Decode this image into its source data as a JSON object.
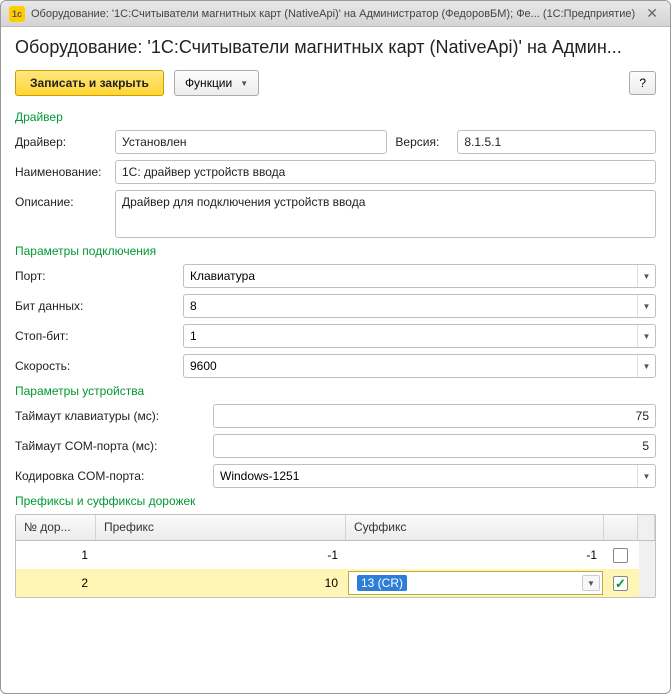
{
  "titlebar": {
    "text": "Оборудование: '1С:Считыватели магнитных карт (NativeApi)' на Администратор (ФедоровБМ); Фе...  (1С:Предприятие)"
  },
  "pageTitle": "Оборудование: '1С:Считыватели магнитных карт (NativeApi)' на Админ...",
  "toolbar": {
    "save": "Записать и закрыть",
    "functions": "Функции",
    "help": "?"
  },
  "sections": {
    "driver": "Драйвер",
    "connectionParams": "Параметры подключения",
    "deviceParams": "Параметры устройства",
    "trackAffixes": "Префиксы и суффиксы дорожек"
  },
  "driver": {
    "labels": {
      "driver": "Драйвер:",
      "version": "Версия:",
      "name": "Наименование:",
      "description": "Описание:"
    },
    "status": "Установлен",
    "version": "8.1.5.1",
    "name": "1С: драйвер устройств ввода",
    "description": "Драйвер для подключения устройств ввода"
  },
  "connection": {
    "labels": {
      "port": "Порт:",
      "dataBits": "Бит данных:",
      "stopBit": "Стоп-бит:",
      "speed": "Скорость:"
    },
    "port": "Клавиатура",
    "dataBits": "8",
    "stopBit": "1",
    "speed": "9600"
  },
  "device": {
    "labels": {
      "kbTimeout": "Таймаут клавиатуры (мс):",
      "comTimeout": "Таймаут COM-порта (мс):",
      "comEncoding": "Кодировка COM-порта:"
    },
    "kbTimeout": "75",
    "comTimeout": "5",
    "comEncoding": "Windows-1251"
  },
  "grid": {
    "headers": {
      "track": "№ дор...",
      "prefix": "Префикс",
      "suffix": "Суффикс"
    },
    "rows": [
      {
        "track": "1",
        "prefix": "-1",
        "suffix": "-1",
        "checked": false,
        "selected": false
      },
      {
        "track": "2",
        "prefix": "10",
        "suffix": "13 (CR)",
        "checked": true,
        "selected": true
      }
    ]
  }
}
